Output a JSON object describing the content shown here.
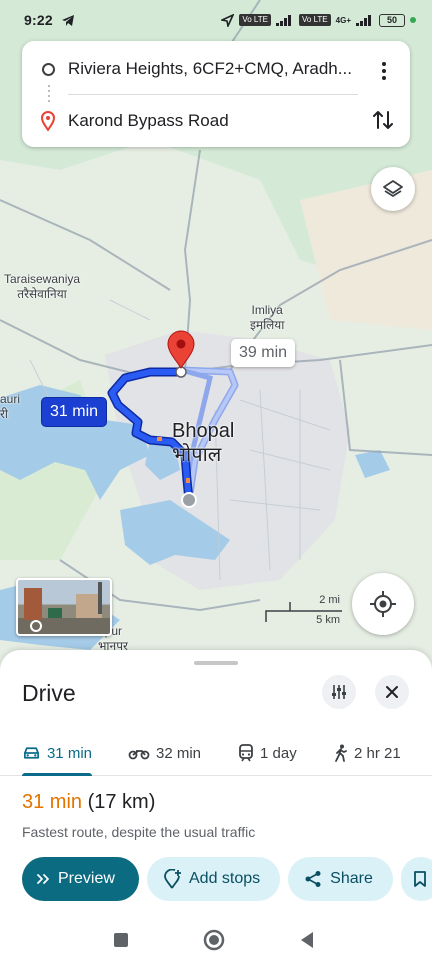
{
  "status_bar": {
    "time": "9:22",
    "network_1": "Vo LTE",
    "network_2": "4G+",
    "battery": "50"
  },
  "route_card": {
    "origin": "Riviera Heights, 6CF2+CMQ, Aradh...",
    "destination": "Karond Bypass Road"
  },
  "map": {
    "labels": {
      "taraisewaniya_en": "Taraisewaniya",
      "taraisewaniya_hi": "तरैसेवानिया",
      "imliya_en": "Imliya",
      "imliya_hi": "इमलिया",
      "city_en": "Bhopal",
      "city_hi": "भोपाल",
      "left_partial_en": "auri",
      "left_partial_hi": "री",
      "bottom_partial_en": "npur",
      "bottom_partial_hi": "भानपर"
    },
    "primary_route_time": "31 min",
    "alt_route_time": "39 min",
    "scale_mi": "2 mi",
    "scale_km": "5 km",
    "colors": {
      "route": "#1a3fd1",
      "alt_route": "#a7b7f0",
      "water": "#9fc7e6",
      "park": "#c6e6cf",
      "urban": "#e3e4e6"
    }
  },
  "sheet": {
    "title": "Drive",
    "modes": [
      {
        "icon": "car-icon",
        "label": "31 min",
        "active": true
      },
      {
        "icon": "motorbike-icon",
        "label": "32 min"
      },
      {
        "icon": "train-icon",
        "label": "1 day"
      },
      {
        "icon": "walk-icon",
        "label": "2 hr 21"
      }
    ],
    "duration": "31 min",
    "distance": "(17 km)",
    "subtitle": "Fastest route, despite the usual traffic",
    "actions": {
      "preview": "Preview",
      "add_stops": "Add stops",
      "share": "Share"
    }
  }
}
